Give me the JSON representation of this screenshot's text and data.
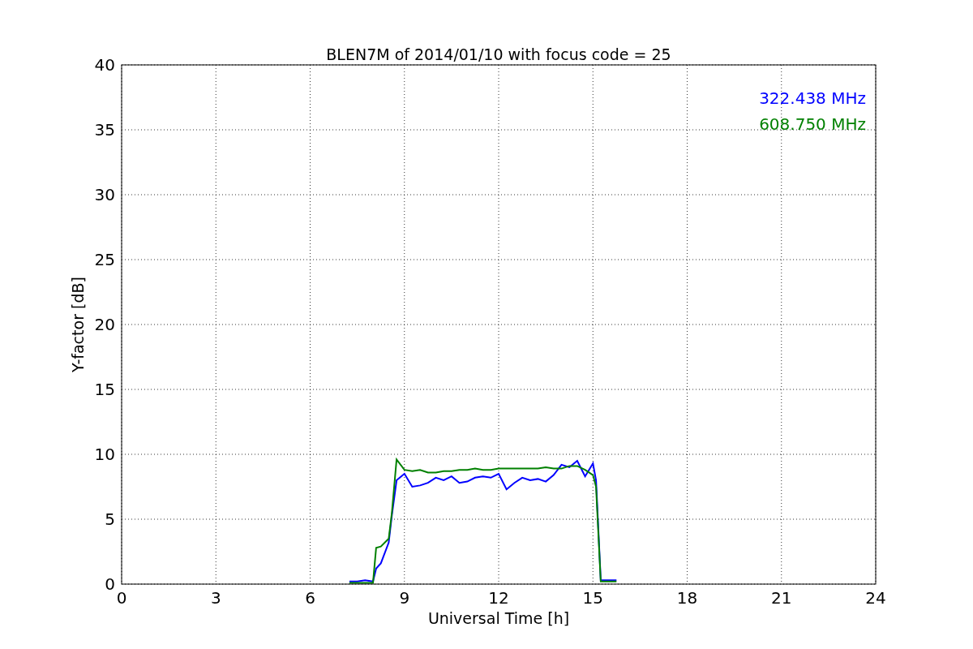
{
  "chart_data": {
    "type": "line",
    "title": "BLEN7M of 2014/01/10 with focus code = 25",
    "xlabel": "Universal Time [h]",
    "ylabel": "Y-factor [dB]",
    "x": [
      7.25,
      7.5,
      7.75,
      8.0,
      8.1,
      8.25,
      8.5,
      8.6,
      8.75,
      9.0,
      9.25,
      9.5,
      9.75,
      10.0,
      10.25,
      10.5,
      10.75,
      11.0,
      11.25,
      11.5,
      11.75,
      12.0,
      12.25,
      12.5,
      12.75,
      13.0,
      13.25,
      13.5,
      13.75,
      14.0,
      14.25,
      14.5,
      14.75,
      15.0,
      15.1,
      15.25,
      15.5,
      15.75
    ],
    "series": [
      {
        "name": "322.438 MHz",
        "color": "#0000ff",
        "values": [
          0.2,
          0.2,
          0.3,
          0.2,
          1.2,
          1.6,
          3.2,
          5.3,
          8.0,
          8.5,
          7.5,
          7.6,
          7.8,
          8.2,
          8.0,
          8.3,
          7.8,
          7.9,
          8.2,
          8.3,
          8.2,
          8.5,
          7.3,
          7.8,
          8.2,
          8.0,
          8.1,
          7.9,
          8.4,
          9.2,
          9.0,
          9.5,
          8.3,
          9.3,
          8.0,
          0.3,
          0.3,
          0.3
        ]
      },
      {
        "name": "608.750 MHz",
        "color": "#008000",
        "values": [
          0.1,
          0.1,
          0.1,
          0.1,
          2.8,
          2.9,
          3.5,
          5.5,
          9.6,
          8.8,
          8.7,
          8.8,
          8.6,
          8.6,
          8.7,
          8.7,
          8.8,
          8.8,
          8.9,
          8.8,
          8.8,
          8.9,
          8.9,
          8.9,
          8.9,
          8.9,
          8.9,
          9.0,
          8.9,
          8.9,
          9.1,
          9.1,
          8.8,
          8.4,
          7.5,
          0.2,
          0.2,
          0.2
        ]
      }
    ],
    "grid": true,
    "xlim": [
      0,
      24
    ],
    "ylim": [
      0,
      40
    ],
    "xticks": [
      0,
      3,
      6,
      9,
      12,
      15,
      18,
      21,
      24
    ],
    "yticks": [
      0,
      5,
      10,
      15,
      20,
      25,
      30,
      35,
      40
    ]
  }
}
